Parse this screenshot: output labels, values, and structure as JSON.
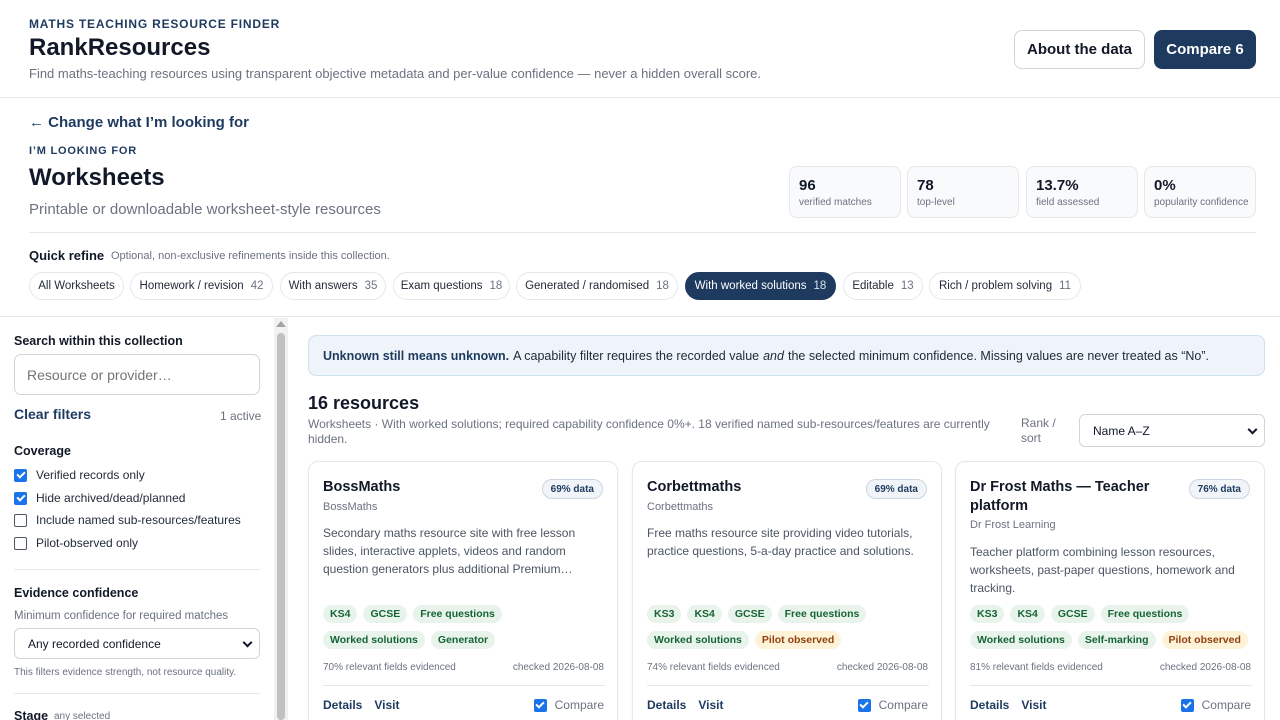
{
  "header": {
    "eyebrow": "MATHS TEACHING RESOURCE FINDER",
    "title": "RankResources",
    "tagline": "Find maths-teaching resources using transparent objective metadata and per-value confidence — never a hidden overall score.",
    "about_label": "About the data",
    "compare_label": "Compare 6"
  },
  "collection": {
    "back_link": "← Change what I’m looking for",
    "looking_label": "I’M LOOKING FOR",
    "title": "Worksheets",
    "description": "Printable or downloadable worksheet-style resources",
    "stats": [
      {
        "value": "96",
        "label": "verified matches"
      },
      {
        "value": "78",
        "label": "top-level"
      },
      {
        "value": "13.7%",
        "label": "field assessed"
      },
      {
        "value": "0%",
        "label": "popularity confidence"
      }
    ]
  },
  "quick_refine": {
    "label": "Quick refine",
    "subtitle": "Optional, non-exclusive refinements inside this collection.",
    "chips": [
      {
        "label": "All Worksheets",
        "count": ""
      },
      {
        "label": "Homework / revision",
        "count": "42"
      },
      {
        "label": "With answers",
        "count": "35"
      },
      {
        "label": "Exam questions",
        "count": "18"
      },
      {
        "label": "Generated / randomised",
        "count": "18"
      },
      {
        "label": "With worked solutions",
        "count": "18"
      },
      {
        "label": "Editable",
        "count": "13"
      },
      {
        "label": "Rich / problem solving",
        "count": "11"
      }
    ]
  },
  "sidebar": {
    "search_title": "Search within this collection",
    "search_placeholder": "Resource or provider…",
    "clear_filters": "Clear filters",
    "active_count": "1 active",
    "coverage_title": "Coverage",
    "coverage_options": [
      {
        "label": "Verified records only",
        "checked": true
      },
      {
        "label": "Hide archived/dead/planned",
        "checked": true
      },
      {
        "label": "Include named sub-resources/features",
        "checked": false
      },
      {
        "label": "Pilot-observed only",
        "checked": false
      }
    ],
    "evidence_title": "Evidence confidence",
    "evidence_sub": "Minimum confidence for required matches",
    "evidence_value": "Any recorded confidence",
    "evidence_note": "This filters evidence strength, not resource quality.",
    "stage_title": "Stage",
    "stage_sub": "any selected"
  },
  "main": {
    "notice_bold": "Unknown still means unknown.",
    "notice_text_1": "A capability filter requires the recorded value",
    "notice_em": "and",
    "notice_text_2": "the selected minimum confidence. Missing values are never treated as “No”.",
    "results_title": "16 resources",
    "results_sub": "Worksheets · With worked solutions; required capability confidence 0%+. 18 verified named sub-resources/features are currently hidden.",
    "rank_label": "Rank / sort",
    "sort_value": "Name A–Z"
  },
  "cards": [
    {
      "title": "BossMaths",
      "provider": "BossMaths",
      "badge": "69% data",
      "description": "Secondary maths resource site with free lesson slides, interactive applets, videos and random question generators plus additional Premium…",
      "tags": [
        {
          "label": "KS4",
          "tone": "green"
        },
        {
          "label": "GCSE",
          "tone": "green"
        },
        {
          "label": "Free questions",
          "tone": "green"
        },
        {
          "label": "Worked solutions",
          "tone": "green"
        },
        {
          "label": "Generator",
          "tone": "green"
        }
      ],
      "evidence": "70% relevant fields evidenced",
      "checked": "checked 2026-08-08",
      "details": "Details",
      "visit": "Visit",
      "compare": "Compare",
      "compared": true
    },
    {
      "title": "Corbettmaths",
      "provider": "Corbettmaths",
      "badge": "69% data",
      "description": "Free maths resource site providing video tutorials, practice questions, 5-a-day practice and solutions.",
      "tags": [
        {
          "label": "KS3",
          "tone": "green"
        },
        {
          "label": "KS4",
          "tone": "green"
        },
        {
          "label": "GCSE",
          "tone": "green"
        },
        {
          "label": "Free questions",
          "tone": "green"
        },
        {
          "label": "Worked solutions",
          "tone": "green"
        },
        {
          "label": "Pilot observed",
          "tone": "amber"
        }
      ],
      "evidence": "74% relevant fields evidenced",
      "checked": "checked 2026-08-08",
      "details": "Details",
      "visit": "Visit",
      "compare": "Compare",
      "compared": true
    },
    {
      "title": "Dr Frost Maths — Teacher platform",
      "provider": "Dr Frost Learning",
      "badge": "76% data",
      "description": "Teacher platform combining lesson resources, worksheets, past-paper questions, homework and tracking.",
      "tags": [
        {
          "label": "KS3",
          "tone": "green"
        },
        {
          "label": "KS4",
          "tone": "green"
        },
        {
          "label": "GCSE",
          "tone": "green"
        },
        {
          "label": "Free questions",
          "tone": "green"
        },
        {
          "label": "Worked solutions",
          "tone": "green"
        },
        {
          "label": "Self-marking",
          "tone": "green"
        },
        {
          "label": "Pilot observed",
          "tone": "amber"
        }
      ],
      "evidence": "81% relevant fields evidenced",
      "checked": "checked 2026-08-08",
      "details": "Details",
      "visit": "Visit",
      "compare": "Compare",
      "compared": true
    }
  ]
}
